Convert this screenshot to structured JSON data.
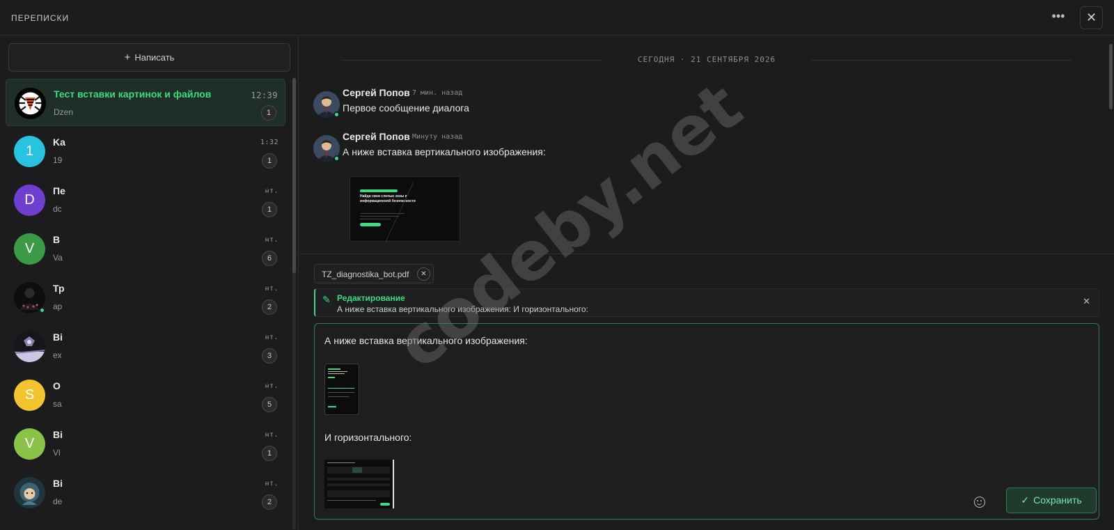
{
  "header": {
    "title": "ПЕРЕПИСКИ",
    "more_icon": "more-horizontal-icon",
    "close_icon": "close-icon"
  },
  "sidebar": {
    "compose_label": "Написать",
    "conversations": [
      {
        "name": "Тест вставки картинок и файлов",
        "preview": "Dzen",
        "time": "12:39",
        "unread": "1",
        "active": true,
        "avatar_letter": "",
        "avatar_color": "#000000"
      },
      {
        "name": "Ka",
        "preview": "19",
        "time": "1:32",
        "unread": "1",
        "active": false,
        "avatar_letter": "1",
        "avatar_color": "#27c3e0"
      },
      {
        "name": "Пе",
        "preview": "dc",
        "time": "нт.",
        "unread": "1",
        "active": false,
        "avatar_letter": "D",
        "avatar_color": "#6f3fd0"
      },
      {
        "name": "В",
        "preview": "Va",
        "time": "нт.",
        "unread": "6",
        "active": false,
        "avatar_letter": "V",
        "avatar_color": "#3a9a48"
      },
      {
        "name": "Тр",
        "preview": "ap",
        "time": "нт.",
        "unread": "2",
        "active": false,
        "avatar_letter": "",
        "avatar_color": "#0e0e0e"
      },
      {
        "name": "Ві",
        "preview": "ex",
        "time": "нт.",
        "unread": "3",
        "active": false,
        "avatar_letter": "",
        "avatar_color": "#15151a"
      },
      {
        "name": "О",
        "preview": "sa",
        "time": "нт.",
        "unread": "5",
        "active": false,
        "avatar_letter": "S",
        "avatar_color": "#f4c430"
      },
      {
        "name": "Ві",
        "preview": "Vl",
        "time": "нт.",
        "unread": "1",
        "active": false,
        "avatar_letter": "V",
        "avatar_color": "#8bc34a"
      },
      {
        "name": "Ві",
        "preview": "de",
        "time": "нт.",
        "unread": "2",
        "active": false,
        "avatar_letter": "",
        "avatar_color": "#20343d"
      }
    ]
  },
  "chat": {
    "date_separator": "СЕГОДНЯ · 21 СЕНТЯБРЯ 2026",
    "messages": [
      {
        "author": "Сергей Попов",
        "time": "7 мин. назад",
        "text": "Первое сообщение диалога"
      },
      {
        "author": "Сергей Попов",
        "time": "Минуту назад",
        "text": "А ниже вставка вертикального изображения:"
      }
    ],
    "image_caption_title": "Найди свои слепые зоны в информационной безопасности"
  },
  "composer": {
    "attachment_name": "TZ_diagnostika_bot.pdf",
    "edit_label": "Редактирование",
    "edit_quote": "А ниже вставка вертикального изображения: И горизонтального:",
    "editor_line1": "А ниже вставка вертикального изображения:",
    "editor_line2": "И горизонтального:",
    "save_label": "Сохранить"
  },
  "watermark": "codeby.net",
  "colors": {
    "accent": "#3ddc84",
    "background": "#1c1c1e"
  }
}
